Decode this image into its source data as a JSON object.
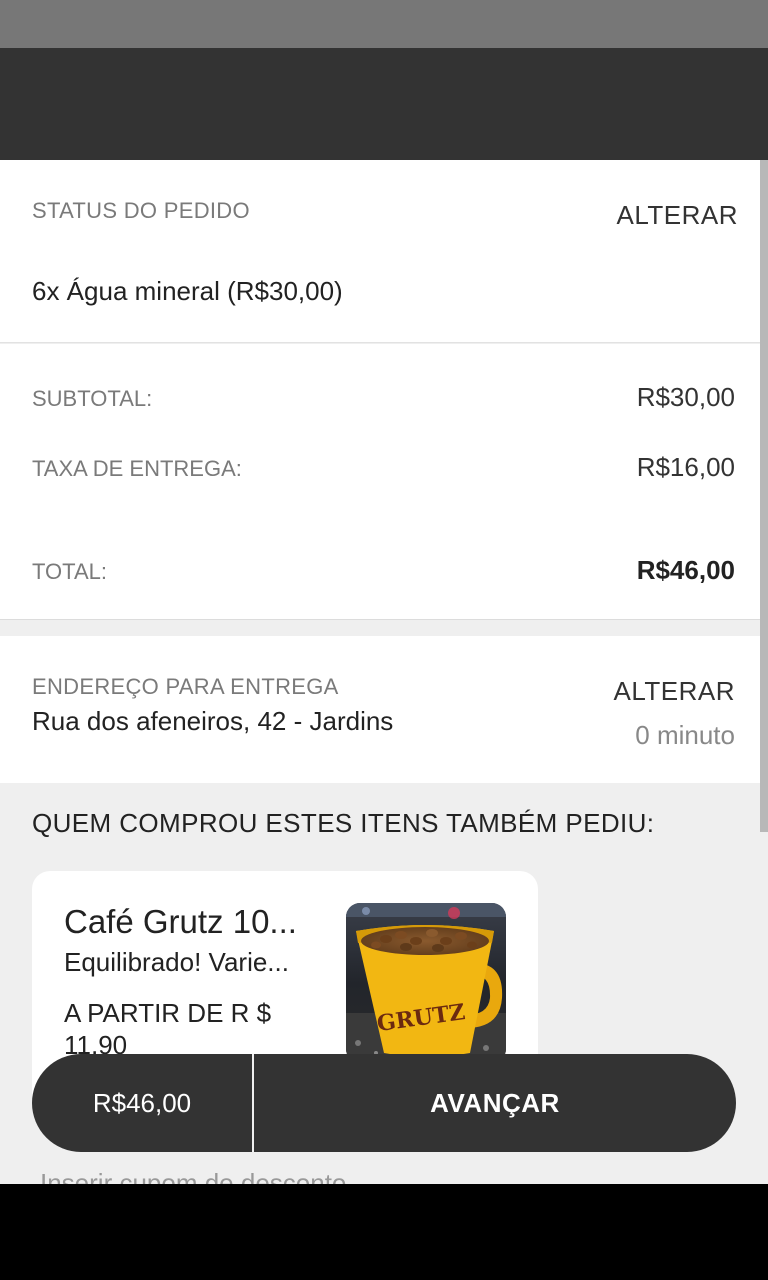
{
  "order_status": {
    "title": "STATUS DO PEDIDO",
    "alter_label": "ALTERAR",
    "items_line": "6x Água mineral (R$30,00)"
  },
  "totals": {
    "subtotal_label": "SUBTOTAL:",
    "subtotal_value": "R$30,00",
    "delivery_fee_label": "TAXA DE ENTREGA:",
    "delivery_fee_value": "R$16,00",
    "total_label": "TOTAL:",
    "total_value": "R$46,00"
  },
  "address": {
    "title": "ENDEREÇO PARA ENTREGA",
    "line": "Rua dos afeneiros, 42 - Jardins",
    "alter_label": "ALTERAR",
    "eta": "0 minuto"
  },
  "suggestions": {
    "title": "QUEM COMPROU ESTES ITENS TAMBÉM PEDIU:",
    "items": [
      {
        "name": "Café Grutz 10...",
        "description": "Equilibrado!  Varie...",
        "price": "A PARTIR DE R $ 11,90",
        "mug_text": "GRUTZ"
      }
    ]
  },
  "coupon": {
    "label": "Inserir cupom de desconto"
  },
  "checkout_bar": {
    "price": "R$46,00",
    "advance_label": "AVANÇAR"
  },
  "colors": {
    "status_bar": "#777777",
    "app_bar": "#333333",
    "button_bg": "#333333",
    "page_bg": "#efefef",
    "mug_yellow": "#f2b712"
  }
}
